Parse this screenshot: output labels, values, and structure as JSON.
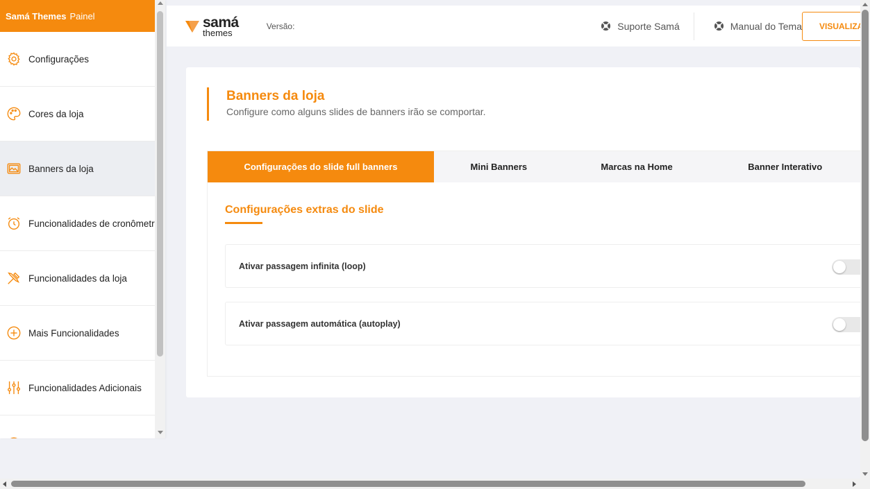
{
  "sidebar": {
    "header": {
      "brand": "Samá Themes",
      "label": "Painel"
    },
    "items": [
      {
        "label": "Configurações",
        "icon": "gear-icon"
      },
      {
        "label": "Cores da loja",
        "icon": "palette-icon"
      },
      {
        "label": "Banners da loja",
        "icon": "image-icon",
        "active": true
      },
      {
        "label": "Funcionalidades de cronômetro",
        "icon": "alarm-clock-icon"
      },
      {
        "label": "Funcionalidades da loja",
        "icon": "tools-icon"
      },
      {
        "label": "Mais Funcionalidades",
        "icon": "plus-circle-icon"
      },
      {
        "label": "Funcionalidades Adicionais",
        "icon": "sliders-icon"
      }
    ]
  },
  "topbar": {
    "logo_line1": "samá",
    "logo_line2": "themes",
    "version_label": "Versão:",
    "support_link": "Suporte Samá",
    "manual_link": "Manual do Tema",
    "visualize_button": "VISUALIZAR"
  },
  "section": {
    "title": "Banners da loja",
    "subtitle": "Configure como alguns slides de banners irão se comportar."
  },
  "tabs": [
    {
      "label": "Configurações do slide full banners",
      "active": true
    },
    {
      "label": "Mini Banners"
    },
    {
      "label": "Marcas na Home"
    },
    {
      "label": "Banner Interativo"
    }
  ],
  "extras": {
    "title": "Configurações extras do slide",
    "options": [
      {
        "label": "Ativar passagem infinita (loop)",
        "enabled": false
      },
      {
        "label": "Ativar passagem automática (autoplay)",
        "enabled": false
      }
    ]
  },
  "colors": {
    "accent": "#f58a0e",
    "background": "#f0f1f6"
  }
}
